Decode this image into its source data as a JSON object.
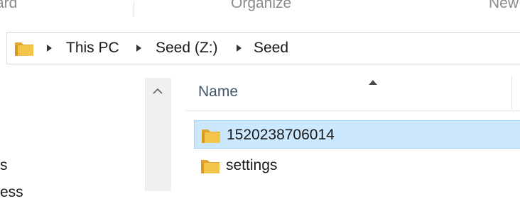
{
  "ribbon": {
    "groups": [
      "ard",
      "Organize",
      "New"
    ]
  },
  "address_bar": {
    "breadcrumb": [
      "This PC",
      "Seed (Z:)",
      "Seed"
    ]
  },
  "nav_pane": {
    "visible_items": [
      "s",
      "ess"
    ]
  },
  "file_list": {
    "column_header": "Name",
    "sort_direction": "ascending",
    "items": [
      {
        "name": "1520238706014",
        "type": "folder",
        "selected": true
      },
      {
        "name": "settings",
        "type": "folder",
        "selected": false
      }
    ]
  },
  "colors": {
    "selection_bg": "#cce8ff",
    "selection_border": "#99d1ff",
    "folder_yellow": "#f3c54b"
  }
}
